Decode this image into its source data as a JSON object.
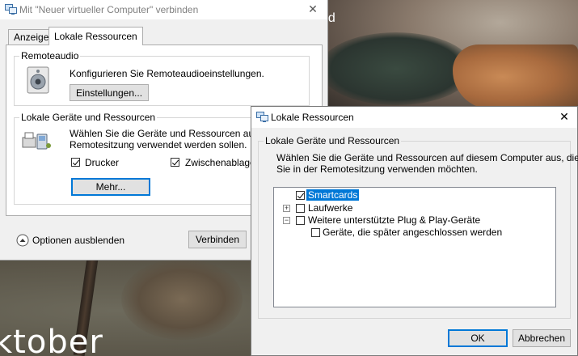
{
  "wallpaper": {
    "text_bottom": "ktober",
    "text_top": "nd"
  },
  "main_window": {
    "title": "Mit \"Neuer virtueller Computer\" verbinden",
    "close_glyph": "✕",
    "tabs": [
      {
        "label": "Anzeige",
        "active": false
      },
      {
        "label": "Lokale Ressourcen",
        "active": true
      }
    ],
    "remote_audio": {
      "group_label": "Remoteaudio",
      "description": "Konfigurieren Sie Remoteaudioeinstellungen.",
      "settings_button": "Einstellungen..."
    },
    "local_devices": {
      "group_label": "Lokale Geräte und Ressourcen",
      "description_line1": "Wählen Sie die Geräte und Ressourcen aus, die",
      "description_line2": "Remotesitzung verwendet werden sollen.",
      "checkboxes": [
        {
          "label": "Drucker",
          "checked": true
        },
        {
          "label": "Zwischenablage",
          "checked": true
        }
      ],
      "more_button": "Mehr..."
    },
    "options_toggle": "Optionen ausblenden",
    "connect_button": "Verbinden"
  },
  "dialog": {
    "title": "Lokale Ressourcen",
    "close_glyph": "✕",
    "group_label": "Lokale Geräte und Ressourcen",
    "description_line1": "Wählen Sie die Geräte und Ressourcen auf diesem Computer aus, die",
    "description_line2": "Sie in der Remotesitzung verwenden möchten.",
    "tree_items": [
      {
        "label": "Smartcards",
        "checked": true,
        "selected": true,
        "expander": ""
      },
      {
        "label": "Laufwerke",
        "checked": false,
        "selected": false,
        "expander": "+"
      },
      {
        "label": "Weitere unterstützte Plug & Play-Geräte",
        "checked": false,
        "selected": false,
        "expander": "−"
      },
      {
        "label": "Geräte, die später angeschlossen werden",
        "checked": false,
        "selected": false,
        "expander": ""
      }
    ],
    "ok_button": "OK",
    "cancel_button": "Abbrechen"
  },
  "colors": {
    "accent": "#0078d7",
    "window_bg": "#f0f0f0"
  }
}
